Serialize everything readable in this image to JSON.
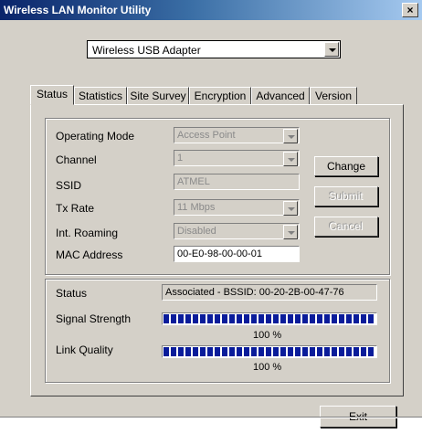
{
  "window": {
    "title": "Wireless LAN Monitor Utility",
    "close_glyph": "×"
  },
  "adapter": {
    "selected": "Wireless USB Adapter"
  },
  "tabs": [
    {
      "label": "Status"
    },
    {
      "label": "Statistics"
    },
    {
      "label": "Site Survey"
    },
    {
      "label": "Encryption"
    },
    {
      "label": "Advanced"
    },
    {
      "label": "Version"
    }
  ],
  "config": {
    "operating_mode": {
      "label": "Operating Mode",
      "value": "Access Point"
    },
    "channel": {
      "label": "Channel",
      "value": "1"
    },
    "ssid": {
      "label": "SSID",
      "value": "ATMEL"
    },
    "tx_rate": {
      "label": "Tx Rate",
      "value": "11 Mbps"
    },
    "int_roaming": {
      "label": "Int. Roaming",
      "value": "Disabled"
    },
    "mac_address": {
      "label": "MAC Address",
      "value": "00-E0-98-00-00-01"
    }
  },
  "buttons": {
    "change": "Change",
    "submit": "Submit",
    "cancel": "Cancel",
    "exit": "Exit"
  },
  "status": {
    "status_label": "Status",
    "status_value": "Associated - BSSID: 00-20-2B-00-47-76",
    "signal_label": "Signal Strength",
    "signal_percent": 100,
    "signal_text": "100 %",
    "link_label": "Link Quality",
    "link_percent": 100,
    "link_text": "100 %"
  },
  "colors": {
    "title_bar": "#0a246a",
    "progress_fill": "#0a1c9a",
    "face": "#d4d0c8"
  }
}
